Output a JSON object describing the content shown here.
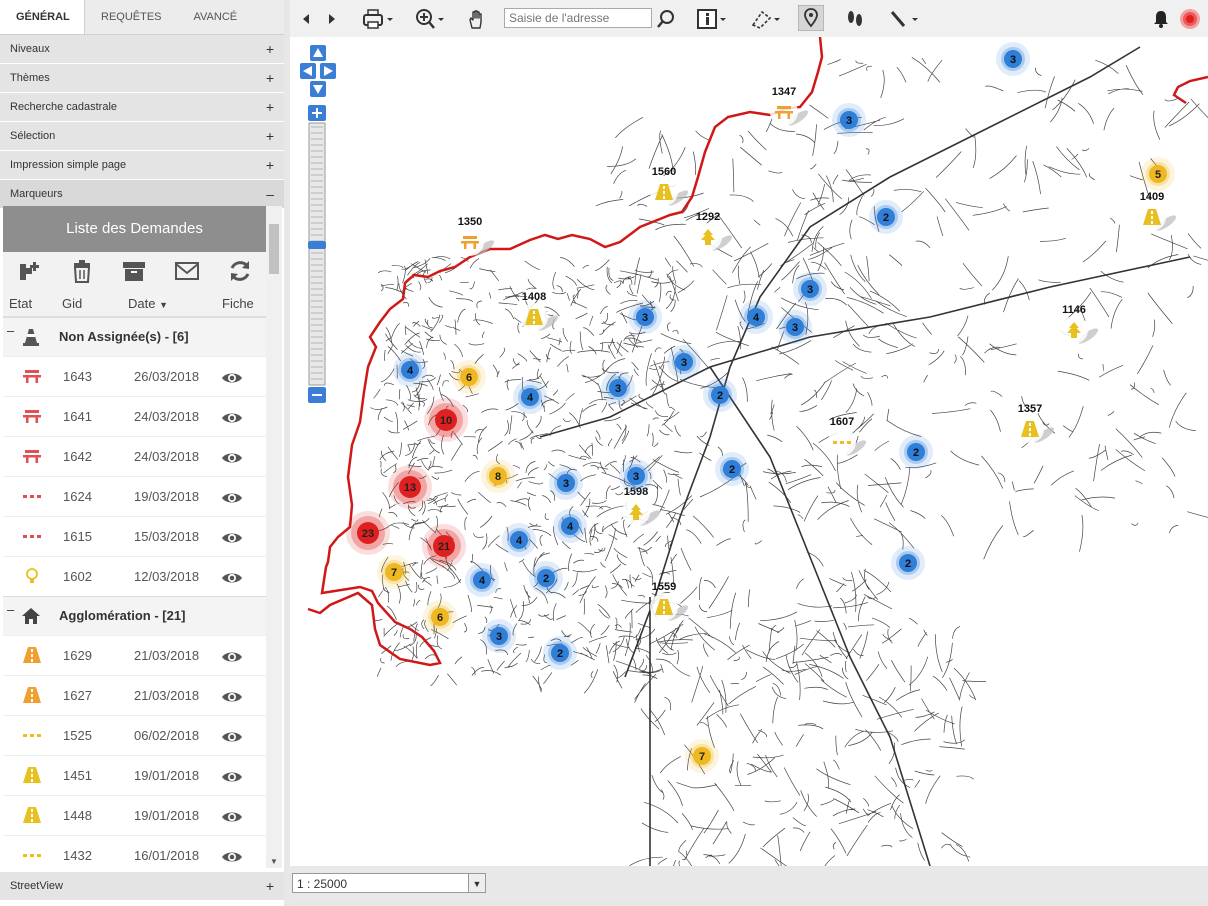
{
  "tabs": [
    "GÉNÉRAL",
    "REQUÊTES",
    "AVANCÉ"
  ],
  "accordion": [
    "Niveaux",
    "Thèmes",
    "Recherche cadastrale",
    "Sélection",
    "Impression simple page",
    "Marqueurs"
  ],
  "list": {
    "title": "Liste des Demandes",
    "columns": {
      "etat": "Etat",
      "gid": "Gid",
      "date": "Date",
      "fiche": "Fiche"
    },
    "groups": [
      {
        "title": "Non Assignée(s) - [6]",
        "icon": "cone-icon",
        "rows": [
          {
            "gid": "1643",
            "date": "26/03/2018",
            "icon": "bench-icon",
            "color": "#e05050"
          },
          {
            "gid": "1641",
            "date": "24/03/2018",
            "icon": "bench-icon",
            "color": "#e05050"
          },
          {
            "gid": "1642",
            "date": "24/03/2018",
            "icon": "bench-icon",
            "color": "#e05050"
          },
          {
            "gid": "1624",
            "date": "19/03/2018",
            "icon": "dots-icon",
            "color": "#e05050"
          },
          {
            "gid": "1615",
            "date": "15/03/2018",
            "icon": "dots-icon",
            "color": "#e05050"
          },
          {
            "gid": "1602",
            "date": "12/03/2018",
            "icon": "bulb-icon",
            "color": "#e8c020"
          }
        ]
      },
      {
        "title": "Agglomération - [21]",
        "icon": "home-icon",
        "rows": [
          {
            "gid": "1629",
            "date": "21/03/2018",
            "icon": "road-icon",
            "color": "#f0a030"
          },
          {
            "gid": "1627",
            "date": "21/03/2018",
            "icon": "road-icon",
            "color": "#f0a030"
          },
          {
            "gid": "1525",
            "date": "06/02/2018",
            "icon": "dots-icon",
            "color": "#e8c020"
          },
          {
            "gid": "1451",
            "date": "19/01/2018",
            "icon": "road-icon",
            "color": "#e8c020"
          },
          {
            "gid": "1448",
            "date": "19/01/2018",
            "icon": "road-icon",
            "color": "#e8c020"
          },
          {
            "gid": "1432",
            "date": "16/01/2018",
            "icon": "dots-icon",
            "color": "#e8c020"
          }
        ]
      }
    ]
  },
  "streetview": "StreetView",
  "search": {
    "placeholder": "Saisie de l'adresse"
  },
  "scale": "1 : 25000",
  "colors": {
    "blue": "#2f7ed8",
    "red": "#e02020",
    "yellow": "#f0b820",
    "boundary": "#d01818"
  },
  "clusters": [
    {
      "n": "3",
      "c": "blue"
    },
    {
      "n": "3",
      "c": "blue"
    },
    {
      "n": "2",
      "c": "blue"
    },
    {
      "n": "5",
      "c": "yellow"
    },
    {
      "n": "3",
      "c": "blue"
    },
    {
      "n": "4",
      "c": "blue"
    },
    {
      "n": "3",
      "c": "blue"
    },
    {
      "n": "3",
      "c": "blue"
    },
    {
      "n": "3",
      "c": "blue"
    },
    {
      "n": "4",
      "c": "blue"
    },
    {
      "n": "6",
      "c": "yellow"
    },
    {
      "n": "3",
      "c": "blue"
    },
    {
      "n": "4",
      "c": "blue"
    },
    {
      "n": "2",
      "c": "blue"
    },
    {
      "n": "10",
      "c": "red"
    },
    {
      "n": "2",
      "c": "blue"
    },
    {
      "n": "2",
      "c": "blue"
    },
    {
      "n": "8",
      "c": "yellow"
    },
    {
      "n": "13",
      "c": "red"
    },
    {
      "n": "3",
      "c": "blue"
    },
    {
      "n": "3",
      "c": "blue"
    },
    {
      "n": "4",
      "c": "blue"
    },
    {
      "n": "23",
      "c": "red"
    },
    {
      "n": "21",
      "c": "red"
    },
    {
      "n": "4",
      "c": "blue"
    },
    {
      "n": "7",
      "c": "yellow"
    },
    {
      "n": "2",
      "c": "blue"
    },
    {
      "n": "2",
      "c": "blue"
    },
    {
      "n": "4",
      "c": "blue"
    },
    {
      "n": "6",
      "c": "yellow"
    },
    {
      "n": "3",
      "c": "blue"
    },
    {
      "n": "2",
      "c": "blue"
    },
    {
      "n": "7",
      "c": "yellow"
    }
  ],
  "markers": [
    {
      "label": "1347",
      "icon": "bench-icon"
    },
    {
      "label": "1560",
      "icon": "road-icon"
    },
    {
      "label": "1292",
      "icon": "tree-icon"
    },
    {
      "label": "1350",
      "icon": "bench-icon"
    },
    {
      "label": "1409",
      "icon": "road-icon"
    },
    {
      "label": "1408",
      "icon": "road-icon"
    },
    {
      "label": "1146",
      "icon": "tree-icon"
    },
    {
      "label": "1607",
      "icon": "dots-icon"
    },
    {
      "label": "1357",
      "icon": "road-icon"
    },
    {
      "label": "1598",
      "icon": "tree-icon"
    },
    {
      "label": "1559",
      "icon": "road-icon"
    }
  ]
}
